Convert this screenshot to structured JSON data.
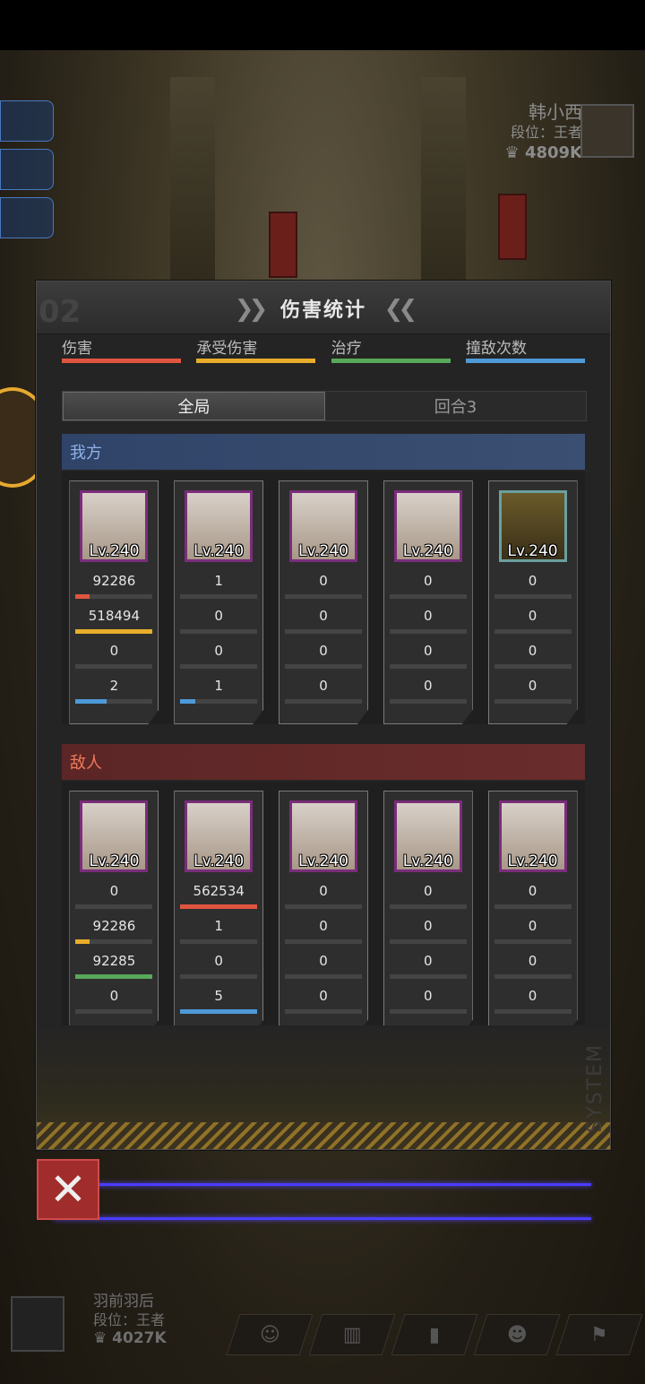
{
  "opponent": {
    "name": "韩小西",
    "rank": "段位：王者",
    "power": "4809K"
  },
  "player": {
    "name": "羽前羽后",
    "rank": "段位：王者",
    "power": "4027K"
  },
  "modal": {
    "watermark": "02",
    "title": "伤害统计",
    "system_text": "SYSTEM",
    "legend": [
      {
        "label": "伤害",
        "color": "#e0553f"
      },
      {
        "label": "承受伤害",
        "color": "#e8ad2a"
      },
      {
        "label": "治疗",
        "color": "#58a85a"
      },
      {
        "label": "撞敌次数",
        "color": "#4d9ad8"
      }
    ],
    "tabs": [
      "全局",
      "回合3"
    ],
    "active_tab": "全局",
    "ours_label": "我方",
    "enemy_label": "敌人",
    "ours": [
      {
        "level": "Lv.240",
        "stats": [
          "92286",
          "518494",
          "0",
          "2"
        ],
        "fill": [
          0.18,
          1.0,
          0,
          0.4
        ]
      },
      {
        "level": "Lv.240",
        "stats": [
          "1",
          "0",
          "0",
          "1"
        ],
        "fill": [
          0,
          0,
          0,
          0.2
        ]
      },
      {
        "level": "Lv.240",
        "stats": [
          "0",
          "0",
          "0",
          "0"
        ],
        "fill": [
          0,
          0,
          0,
          0
        ]
      },
      {
        "level": "Lv.240",
        "stats": [
          "0",
          "0",
          "0",
          "0"
        ],
        "fill": [
          0,
          0,
          0,
          0
        ]
      },
      {
        "level": "Lv.240",
        "stats": [
          "0",
          "0",
          "0",
          "0"
        ],
        "fill": [
          0,
          0,
          0,
          0
        ]
      }
    ],
    "enemy": [
      {
        "level": "Lv.240",
        "stats": [
          "0",
          "92286",
          "92285",
          "0"
        ],
        "fill": [
          0,
          0.18,
          1.0,
          0
        ]
      },
      {
        "level": "Lv.240",
        "stats": [
          "562534",
          "1",
          "0",
          "5"
        ],
        "fill": [
          1.0,
          0,
          0,
          1.0
        ]
      },
      {
        "level": "Lv.240",
        "stats": [
          "0",
          "0",
          "0",
          "0"
        ],
        "fill": [
          0,
          0,
          0,
          0
        ]
      },
      {
        "level": "Lv.240",
        "stats": [
          "0",
          "0",
          "0",
          "0"
        ],
        "fill": [
          0,
          0,
          0,
          0
        ]
      },
      {
        "level": "Lv.240",
        "stats": [
          "0",
          "0",
          "0",
          "0"
        ],
        "fill": [
          0,
          0,
          0,
          0
        ]
      }
    ]
  }
}
